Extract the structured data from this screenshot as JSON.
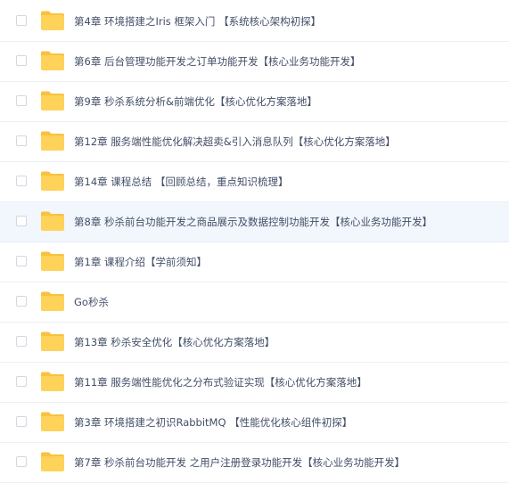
{
  "files": [
    {
      "name": "第4章 环境搭建之Iris 框架入门 【系统核心架构初探】",
      "type": "folder"
    },
    {
      "name": "第6章 后台管理功能开发之订单功能开发【核心业务功能开发】",
      "type": "folder"
    },
    {
      "name": "第9章 秒杀系统分析&前端优化【核心优化方案落地】",
      "type": "folder"
    },
    {
      "name": "第12章 服务端性能优化解决超卖&引入消息队列【核心优化方案落地】",
      "type": "folder"
    },
    {
      "name": "第14章 课程总结 【回顾总结，重点知识梳理】",
      "type": "folder"
    },
    {
      "name": "第8章 秒杀前台功能开发之商品展示及数据控制功能开发【核心业务功能开发】",
      "type": "folder"
    },
    {
      "name": "第1章 课程介绍【学前须知】",
      "type": "folder"
    },
    {
      "name": "Go秒杀",
      "type": "folder"
    },
    {
      "name": "第13章 秒杀安全优化【核心优化方案落地】",
      "type": "folder"
    },
    {
      "name": "第11章 服务端性能优化之分布式验证实现【核心优化方案落地】",
      "type": "folder"
    },
    {
      "name": "第3章 环境搭建之初识RabbitMQ 【性能优化核心组件初探】",
      "type": "folder"
    },
    {
      "name": "第7章 秒杀前台功能开发 之用户注册登录功能开发【核心业务功能开发】",
      "type": "folder"
    }
  ],
  "hovered_index": 5,
  "colors": {
    "folder_body": "#ffd259",
    "folder_tab": "#f7c23f",
    "text": "#424e67",
    "hover_row": "#f2f7fd"
  },
  "icons": {
    "folder": "folder-icon"
  }
}
